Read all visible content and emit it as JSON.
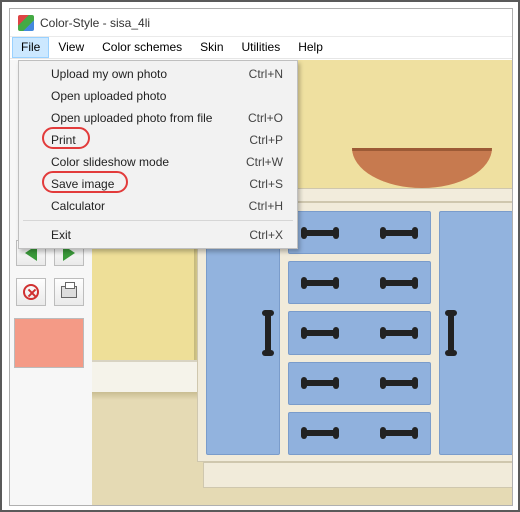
{
  "title": "Color-Style  -  sisa_4li",
  "menubar": [
    "File",
    "View",
    "Color schemes",
    "Skin",
    "Utilities",
    "Help"
  ],
  "menu_open_index": 0,
  "file_menu": [
    {
      "label": "Upload my own photo",
      "shortcut": "Ctrl+N"
    },
    {
      "label": "Open uploaded photo",
      "shortcut": ""
    },
    {
      "label": "Open uploaded photo from file",
      "shortcut": "Ctrl+O"
    },
    {
      "label": "Print",
      "shortcut": "Ctrl+P",
      "highlighted": true
    },
    {
      "label": "Color slideshow mode",
      "shortcut": "Ctrl+W"
    },
    {
      "label": "Save image",
      "shortcut": "Ctrl+S",
      "highlighted": true
    },
    {
      "label": "Calculator",
      "shortcut": "Ctrl+H"
    },
    {
      "sep": true
    },
    {
      "label": "Exit",
      "shortcut": "Ctrl+X"
    }
  ],
  "toolbar": {
    "prev": "previous",
    "next": "next",
    "cancel": "cancel",
    "print": "print"
  },
  "swatch_color": "#f49a86",
  "scene_colors": {
    "wall": "#eedf98",
    "cabinet": "#92b3de",
    "bowl": "#c77a4f",
    "floor": "#e5dab4"
  }
}
